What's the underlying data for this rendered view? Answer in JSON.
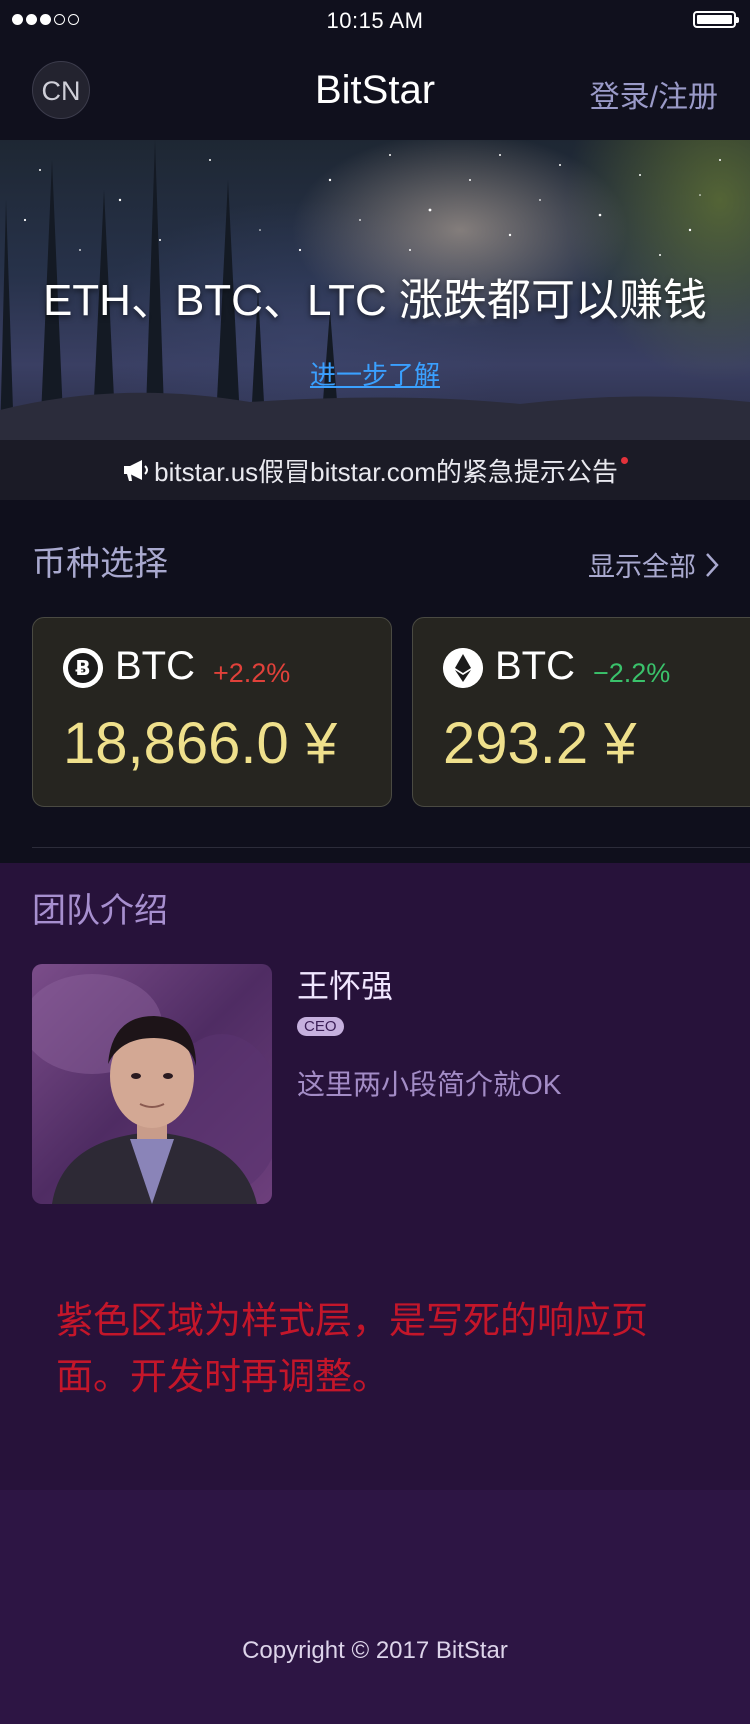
{
  "status_bar": {
    "time": "10:15 AM",
    "signal_bars_filled": 3,
    "signal_bars_total": 5
  },
  "header": {
    "language": "CN",
    "title": "BitStar",
    "login": "登录/注册"
  },
  "banner": {
    "headline": "ETH、BTC、LTC 涨跌都可以赚钱",
    "link": "进一步了解"
  },
  "notice": {
    "text": "bitstar.us假冒bitstar.com的紧急提示公告",
    "icon": "megaphone-icon"
  },
  "coins": {
    "title": "币种选择",
    "show_all": "显示全部",
    "cards": [
      {
        "icon": "bitcoin-icon",
        "name": "BTC",
        "change": "+2.2%",
        "trend": "up",
        "price": "18,866.0 ¥"
      },
      {
        "icon": "ethereum-icon",
        "name": "BTC",
        "change": "−2.2%",
        "trend": "down",
        "price": "293.2 ¥"
      }
    ]
  },
  "team": {
    "title": "团队介绍",
    "member": {
      "name": "王怀强",
      "role": "CEO",
      "bio": "这里两小段简介就OK"
    },
    "note": "紫色区域为样式层，是写死的响应页面。开发时再调整。"
  },
  "footer": {
    "copyright": "Copyright © 2017 BitStar"
  },
  "colors": {
    "background": "#0f0f1c",
    "accent_text": "#a9a9cf",
    "price": "#efe08c",
    "up": "#e0413a",
    "down": "#3ac26b",
    "team_background": "#27123a",
    "note_red": "#c4162a",
    "link_blue": "#3aa0ff"
  }
}
